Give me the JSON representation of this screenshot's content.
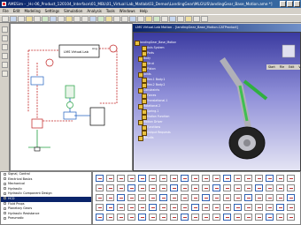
{
  "window": {
    "title": "AMESim - _Hc-06_Product_120104_Interface\\01_MBL\\01_Virtual Lab_Matlab\\03_Demos\\LandingGear\\MLG\\US\\landingGear_Base_Motion.ame *]"
  },
  "menu": [
    "File",
    "Edit",
    "Modeling",
    "Settings",
    "Simulation",
    "Analysis",
    "Tools",
    "Windows",
    "Help"
  ],
  "toolbar": {
    "count": 26
  },
  "sketch": {
    "block_label": "LMS Virtual.Lab",
    "block_port": "Ang"
  },
  "viewer": {
    "title": "LMS Virtual.Lab Motion - [landingGear_Base_Motion.CATProduct]",
    "menu": [
      "Start",
      "File",
      "Edit",
      "View",
      "Insert",
      "Tools",
      "Window",
      "Help"
    ],
    "tree": [
      "landingGear_Base_Motion",
      "Axis System",
      "Parts",
      "Body",
      "Strut",
      "Piston",
      "Joints",
      "Rev.1 Body.1",
      "Rev.2 Body.2",
      "Constraints",
      "Forces",
      "Translational.1",
      "Rotational.2",
      "Spring.1",
      "Motion Function",
      "Motion Driver",
      "Functions",
      "Output Requests",
      "Results"
    ]
  },
  "library": {
    "items": [
      {
        "label": "Signal, Control",
        "selected": false
      },
      {
        "label": "Electrical Basics",
        "selected": false
      },
      {
        "label": "Mechanical",
        "selected": false
      },
      {
        "label": "Hydraulic",
        "selected": false
      },
      {
        "label": "Hydraulic Component Design",
        "selected": false
      },
      {
        "label": "HCD",
        "selected": true
      },
      {
        "label": "Fluid Props",
        "selected": false
      },
      {
        "label": "Planetary Gears",
        "selected": false
      },
      {
        "label": "Hydraulic Resistance",
        "selected": false
      },
      {
        "label": "Pneumatic",
        "selected": false
      }
    ]
  },
  "colors": {
    "accent": "#0a246a",
    "wire": "#c02020",
    "signal": "#2060c0",
    "green": "#20a040"
  }
}
